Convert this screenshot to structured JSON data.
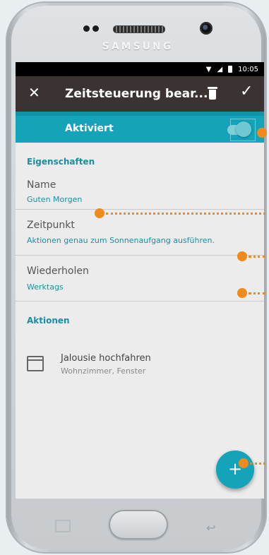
{
  "device": {
    "brand": "SAMSUNG"
  },
  "statusbar": {
    "time": "10:05"
  },
  "appbar": {
    "title": "Zeitsteuerung bear...",
    "close_icon": "close-icon",
    "delete_icon": "trash-icon",
    "confirm_icon": "check-icon"
  },
  "activation": {
    "label": "Aktiviert",
    "enabled": true
  },
  "properties": {
    "section_title": "Eigenschaften",
    "name": {
      "label": "Name",
      "value": "Guten Morgen"
    },
    "time": {
      "label": "Zeitpunkt",
      "value": "Aktionen genau zum Sonnenaufgang ausführen."
    },
    "repeat": {
      "label": "Wiederholen",
      "value": "Werktags"
    }
  },
  "actions": {
    "section_title": "Aktionen",
    "items": [
      {
        "title": "Jalousie hochfahren",
        "subtitle": "Wohnzimmer, Fenster"
      }
    ]
  },
  "fab": {
    "label": "+"
  },
  "colors": {
    "accent": "#14a3b8",
    "appbar": "#3a3331",
    "annotation": "#f08a1c"
  }
}
